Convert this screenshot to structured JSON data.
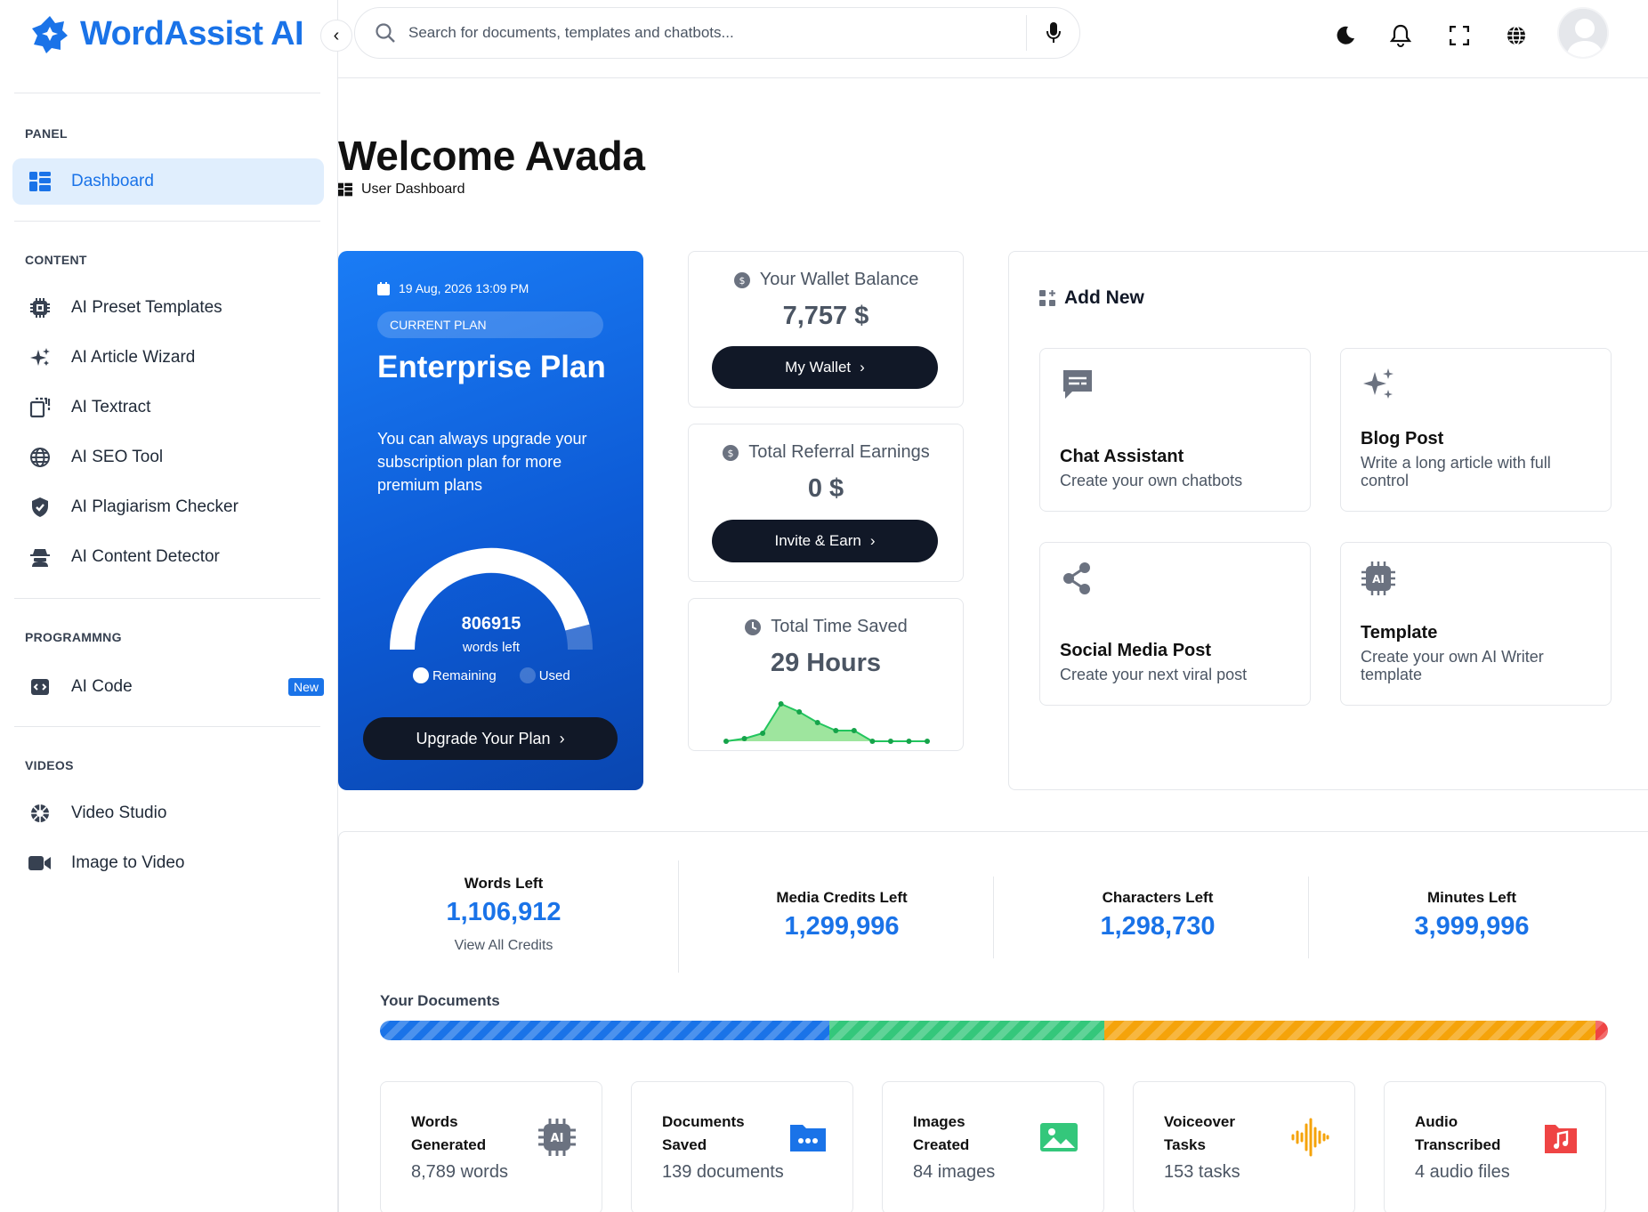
{
  "brand": {
    "name": "WordAssist AI",
    "color": "#1a73e8"
  },
  "search": {
    "placeholder": "Search for documents, templates and chatbots..."
  },
  "sidebar": {
    "sections": {
      "panel": "PANEL",
      "content": "CONTENT",
      "programming": "PROGRAMMNG",
      "videos": "VIDEOS"
    },
    "items": [
      {
        "label": "Dashboard",
        "icon": "dashboard-icon"
      },
      {
        "label": "AI Preset Templates",
        "icon": "ai-chip-icon"
      },
      {
        "label": "AI Article Wizard",
        "icon": "sparkle-icon"
      },
      {
        "label": "AI Textract",
        "icon": "textract-icon"
      },
      {
        "label": "AI SEO Tool",
        "icon": "globe-seo-icon"
      },
      {
        "label": "AI Plagiarism Checker",
        "icon": "shield-check-icon"
      },
      {
        "label": "AI Content Detector",
        "icon": "detective-icon"
      },
      {
        "label": "AI Code",
        "icon": "code-icon",
        "badge": "New"
      },
      {
        "label": "Video Studio",
        "icon": "aperture-icon"
      },
      {
        "label": "Image to Video",
        "icon": "video-camera-icon"
      }
    ]
  },
  "header": {
    "title": "Welcome Avada",
    "breadcrumb": "User Dashboard"
  },
  "plan": {
    "date": "19 Aug, 2026 13:09 PM",
    "pill": "CURRENT PLAN",
    "name": "Enterprise Plan",
    "description": "You can always upgrade your subscription plan for more premium plans",
    "words_left": "806915",
    "words_left_label": "words left",
    "legend_remaining": "Remaining",
    "legend_used": "Used",
    "remaining_fraction": 0.92,
    "upgrade_label": "Upgrade Your Plan"
  },
  "wallet": {
    "title": "Your Wallet Balance",
    "value": "7,757 $",
    "button": "My Wallet"
  },
  "referral": {
    "title": "Total Referral Earnings",
    "value": "0 $",
    "button": "Invite & Earn"
  },
  "time_saved": {
    "title": "Total Time Saved",
    "value": "29 Hours",
    "sparkline": [
      0,
      1,
      3,
      14,
      11,
      7,
      4,
      4,
      0,
      0,
      0,
      0
    ]
  },
  "add_new": {
    "title": "Add New",
    "cards": [
      {
        "title": "Chat Assistant",
        "desc": "Create your own chatbots",
        "icon": "chat-icon"
      },
      {
        "title": "Blog Post",
        "desc": "Write a long article with full control",
        "icon": "sparkle-icon"
      },
      {
        "title": "Social Media Post",
        "desc": "Create your next viral post",
        "icon": "share-icon"
      },
      {
        "title": "Template",
        "desc": "Create your own AI Writer template",
        "icon": "ai-chip-icon"
      }
    ]
  },
  "credits": [
    {
      "label": "Words Left",
      "value": "1,106,912",
      "link": "View All Credits"
    },
    {
      "label": "Media Credits Left",
      "value": "1,299,996"
    },
    {
      "label": "Characters Left",
      "value": "1,298,730"
    },
    {
      "label": "Minutes Left",
      "value": "3,999,996"
    }
  ],
  "documents": {
    "title": "Your Documents",
    "bar": [
      {
        "value": 36.6,
        "color": "#1a73e8"
      },
      {
        "value": 22.4,
        "color": "#34c77b"
      },
      {
        "value": 40.0,
        "color": "#f5a30a"
      },
      {
        "value": 1.0,
        "color": "#ef4444"
      }
    ],
    "cards": [
      {
        "title": "Words Generated",
        "value": "8,789 words",
        "icon": "ai-chip-icon"
      },
      {
        "title": "Documents Saved",
        "value": "139 documents",
        "icon": "folder-icon"
      },
      {
        "title": "Images Created",
        "value": "84 images",
        "icon": "image-icon"
      },
      {
        "title": "Voiceover Tasks",
        "value": "153 tasks",
        "icon": "waveform-icon"
      },
      {
        "title": "Audio Transcribed",
        "value": "4 audio files",
        "icon": "music-file-icon"
      }
    ]
  }
}
